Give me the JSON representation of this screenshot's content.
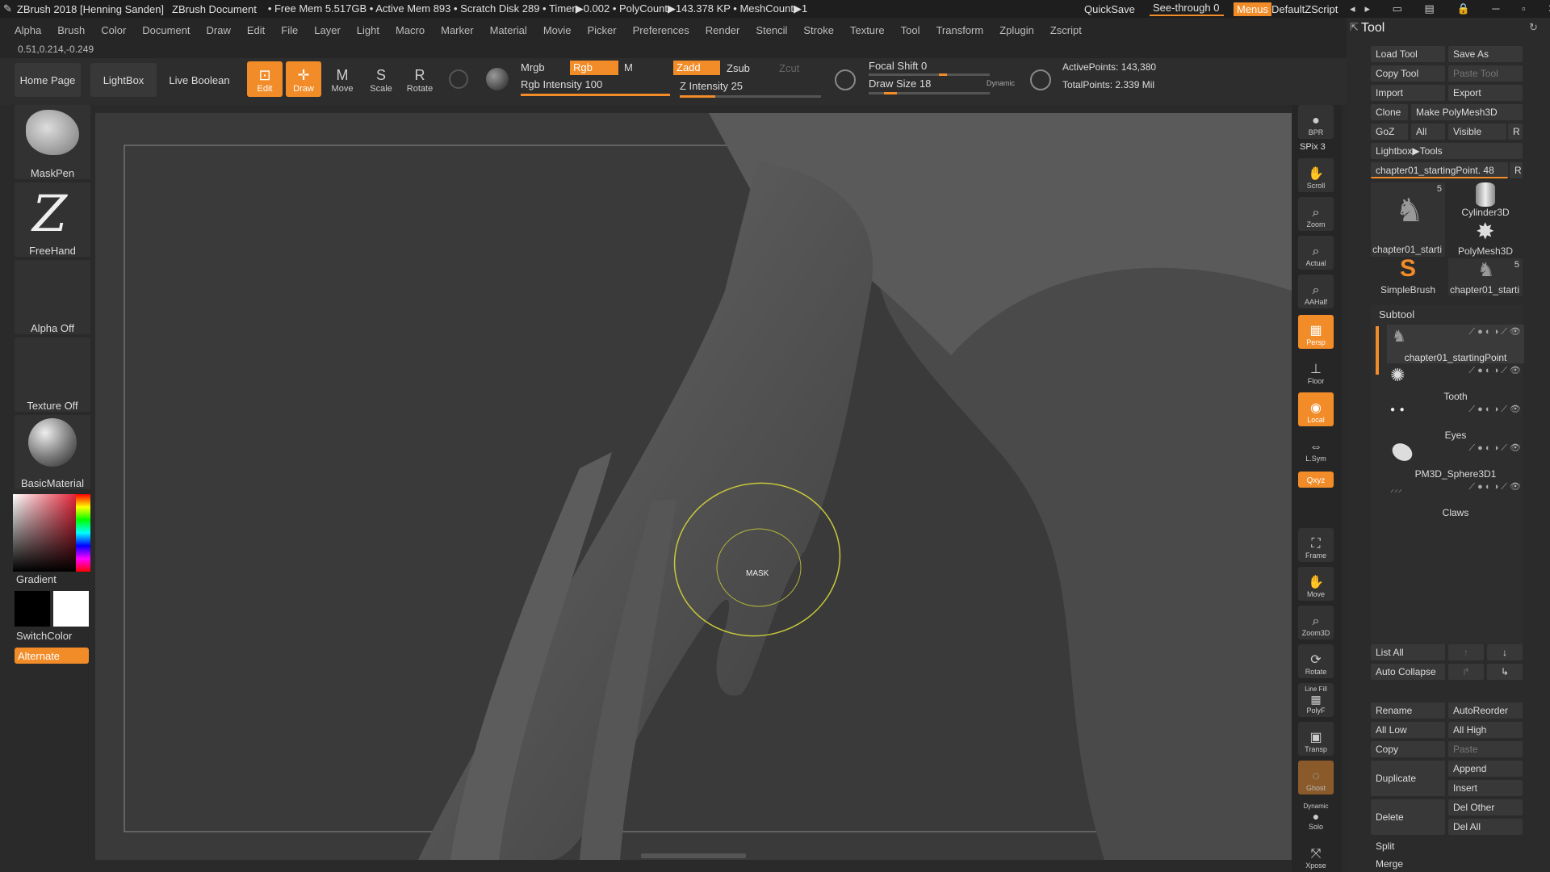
{
  "titlebar": {
    "app": "ZBrush 2018 [Henning Sanden]",
    "document": "ZBrush Document",
    "stats": "• Free Mem 5.517GB • Active Mem 893 • Scratch Disk 289 • Timer▶0.002 • PolyCount▶143.378 KP • MeshCount▶1",
    "quicksave": "QuickSave",
    "seethrough": "See-through",
    "seethrough_value": "0",
    "menus": "Menus",
    "script": "DefaultZScript"
  },
  "menus": [
    "Alpha",
    "Brush",
    "Color",
    "Document",
    "Draw",
    "Edit",
    "File",
    "Layer",
    "Light",
    "Macro",
    "Marker",
    "Material",
    "Movie",
    "Picker",
    "Preferences",
    "Render",
    "Stencil",
    "Stroke",
    "Texture",
    "Tool",
    "Transform",
    "Zplugin",
    "Zscript"
  ],
  "coords": "0.51,0.214,-0.249",
  "topshelf": {
    "home": "Home Page",
    "lightbox": "LightBox",
    "liveboolean": "Live Boolean",
    "edit": "Edit",
    "draw": "Draw",
    "move": "Move",
    "scale": "Scale",
    "rotate": "Rotate",
    "mrgb": "Mrgb",
    "rgb": "Rgb",
    "m": "M",
    "zadd": "Zadd",
    "zsub": "Zsub",
    "zcut": "Zcut",
    "rgb_intensity": "Rgb Intensity 100",
    "z_intensity": "Z Intensity 25",
    "focal_shift": "Focal Shift 0",
    "draw_size": "Draw Size 18",
    "dynamic": "Dynamic",
    "active_points": "ActivePoints: 143,380",
    "total_points": "TotalPoints: 2.339 Mil",
    "rgb_intensity_level": 100,
    "z_intensity_level": 25
  },
  "leftshelf": {
    "brush": "MaskPen",
    "stroke": "FreeHand",
    "alpha": "Alpha Off",
    "texture": "Texture Off",
    "material": "BasicMaterial",
    "gradient": "Gradient",
    "switchcolor": "SwitchColor",
    "alternate": "Alternate"
  },
  "viewport": {
    "cursor_label": "MASK"
  },
  "rightshelf": {
    "bpr": "BPR",
    "spix": "SPix 3",
    "scroll": "Scroll",
    "zoom": "Zoom",
    "actual": "Actual",
    "aahalf": "AAHalf",
    "persp": "Persp",
    "dynamic": "Dynamic",
    "floor": "Floor",
    "local": "Local",
    "lsym": "L.Sym",
    "xyz": "Qxyz",
    "frame": "Frame",
    "move": "Move",
    "zoom3d": "Zoom3D",
    "rotate": "Rotate",
    "linefill": "Line Fill",
    "polyf": "PolyF",
    "transp": "Transp",
    "ghost": "Ghost",
    "solo": "Solo",
    "xpose": "Xpose"
  },
  "tool": {
    "title": "Tool",
    "load": "Load Tool",
    "saveas": "Save As",
    "copy": "Copy Tool",
    "paste": "Paste Tool",
    "import": "Import",
    "export": "Export",
    "clone": "Clone",
    "make": "Make PolyMesh3D",
    "goz": "GoZ",
    "all": "All",
    "visible": "Visible",
    "r": "R",
    "lightboxtools": "Lightbox▶Tools",
    "current": "chapter01_startingPoint. 48",
    "thumbs": [
      {
        "name": "chapter01_starti",
        "count": "5"
      },
      {
        "name": "Cylinder3D"
      },
      {
        "name": "PolyMesh3D"
      },
      {
        "name": "SimpleBrush"
      },
      {
        "name": "chapter01_starti",
        "count": "5"
      }
    ],
    "subtool_title": "Subtool",
    "subtools": [
      "chapter01_startingPoint",
      "Tooth",
      "Eyes",
      "PM3D_Sphere3D1",
      "Claws"
    ],
    "listall": "List All",
    "autocollapse": "Auto Collapse",
    "rename": "Rename",
    "autoreorder": "AutoReorder",
    "alllow": "All Low",
    "allhigh": "All High",
    "copy_st": "Copy",
    "paste_st": "Paste",
    "duplicate": "Duplicate",
    "append": "Append",
    "insert": "Insert",
    "delete": "Delete",
    "delother": "Del Other",
    "delall": "Del All",
    "split": "Split",
    "merge": "Merge"
  }
}
